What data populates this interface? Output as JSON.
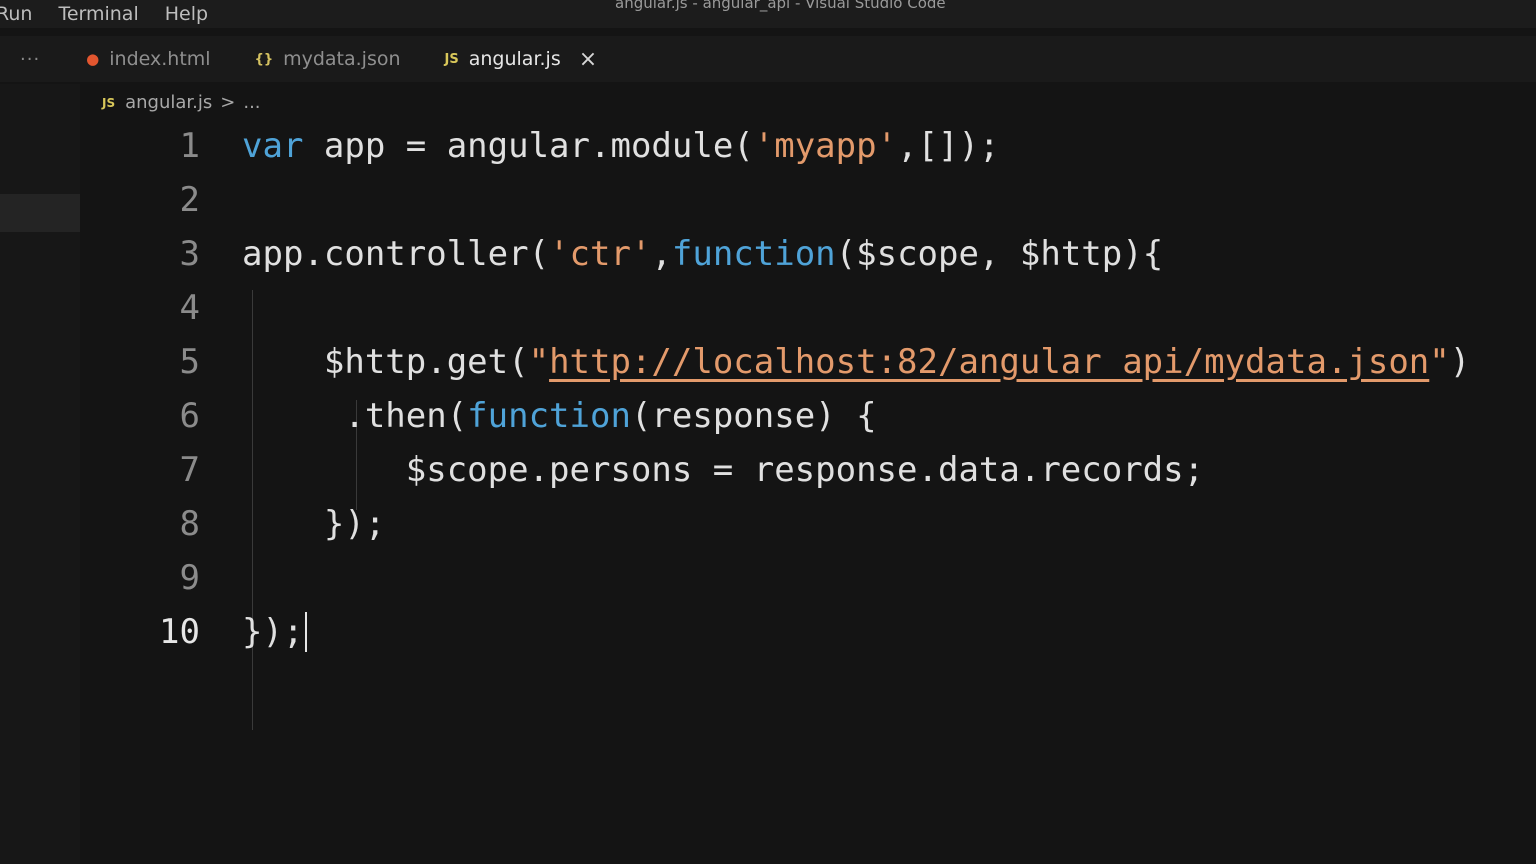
{
  "menubar": {
    "items": [
      "Run",
      "Terminal",
      "Help"
    ],
    "window_title": "angular.js - angular_api - Visual Studio Code"
  },
  "tabs": {
    "more": "···",
    "items": [
      {
        "label": "index.html",
        "icon": "html-file-icon",
        "active": false
      },
      {
        "label": "mydata.json",
        "icon": "json-file-icon",
        "active": false
      },
      {
        "label": "angular.js",
        "icon": "js-file-icon",
        "active": true
      }
    ],
    "close": "×"
  },
  "breadcrumb": {
    "file": "angular.js",
    "separator": ">",
    "rest": "..."
  },
  "editor": {
    "current_line": 10,
    "lines": [
      {
        "num": "1",
        "segments": [
          [
            "kw",
            "var"
          ],
          [
            "t",
            " app = angular.module("
          ],
          [
            "str",
            "'myapp'"
          ],
          [
            "t",
            ",[]);"
          ]
        ]
      },
      {
        "num": "2",
        "segments": []
      },
      {
        "num": "3",
        "segments": [
          [
            "t",
            "app.controller("
          ],
          [
            "str",
            "'ctr'"
          ],
          [
            "t",
            ","
          ],
          [
            "kw",
            "function"
          ],
          [
            "t",
            "($scope, $http){"
          ]
        ]
      },
      {
        "num": "4",
        "segments": []
      },
      {
        "num": "5",
        "segments": [
          [
            "t",
            "    $http.get("
          ],
          [
            "str",
            "\""
          ],
          [
            "url",
            "http://localhost:82/angular_api/mydata.json"
          ],
          [
            "str",
            "\""
          ],
          [
            "t",
            ")"
          ]
        ]
      },
      {
        "num": "6",
        "segments": [
          [
            "t",
            "     .then("
          ],
          [
            "kw",
            "function"
          ],
          [
            "t",
            "(response) {"
          ]
        ]
      },
      {
        "num": "7",
        "segments": [
          [
            "t",
            "        $scope.persons = response.data.records;"
          ]
        ]
      },
      {
        "num": "8",
        "segments": [
          [
            "t",
            "    });"
          ]
        ]
      },
      {
        "num": "9",
        "segments": []
      },
      {
        "num": "10",
        "segments": [
          [
            "t",
            "});"
          ]
        ]
      }
    ]
  },
  "colors": {
    "keyword": "#4fa3d8",
    "string": "#e39a6b",
    "background": "#141414"
  }
}
